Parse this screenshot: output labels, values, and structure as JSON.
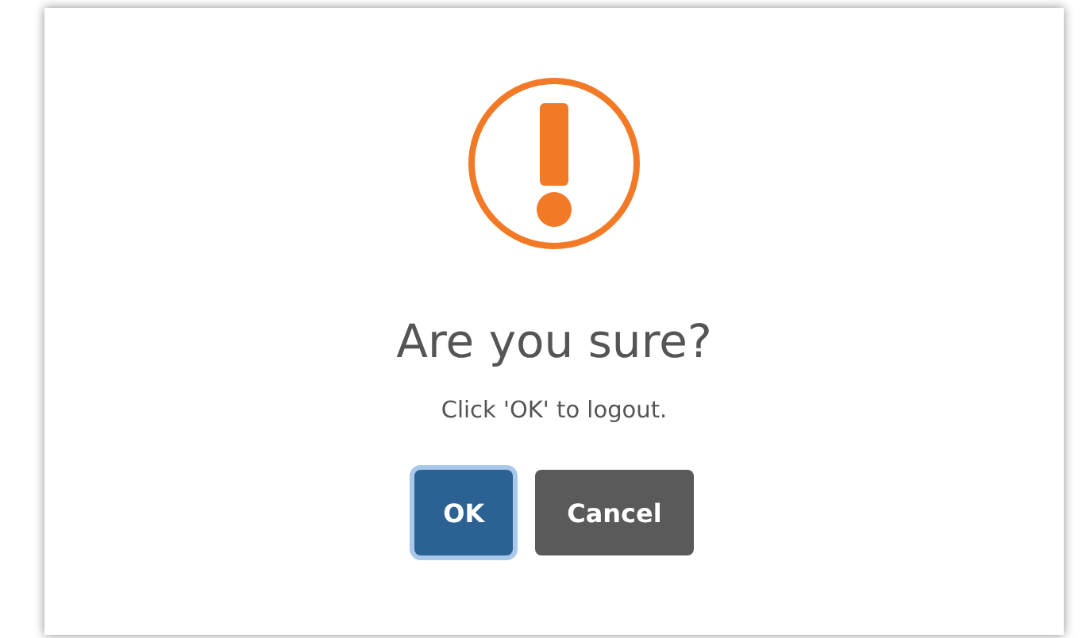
{
  "dialog": {
    "title": "Are you sure?",
    "message": "Click 'OK' to logout.",
    "buttons": [
      {
        "label": "OK",
        "kind": "confirm",
        "focused": true
      },
      {
        "label": "Cancel",
        "kind": "cancel",
        "focused": false
      }
    ]
  }
}
